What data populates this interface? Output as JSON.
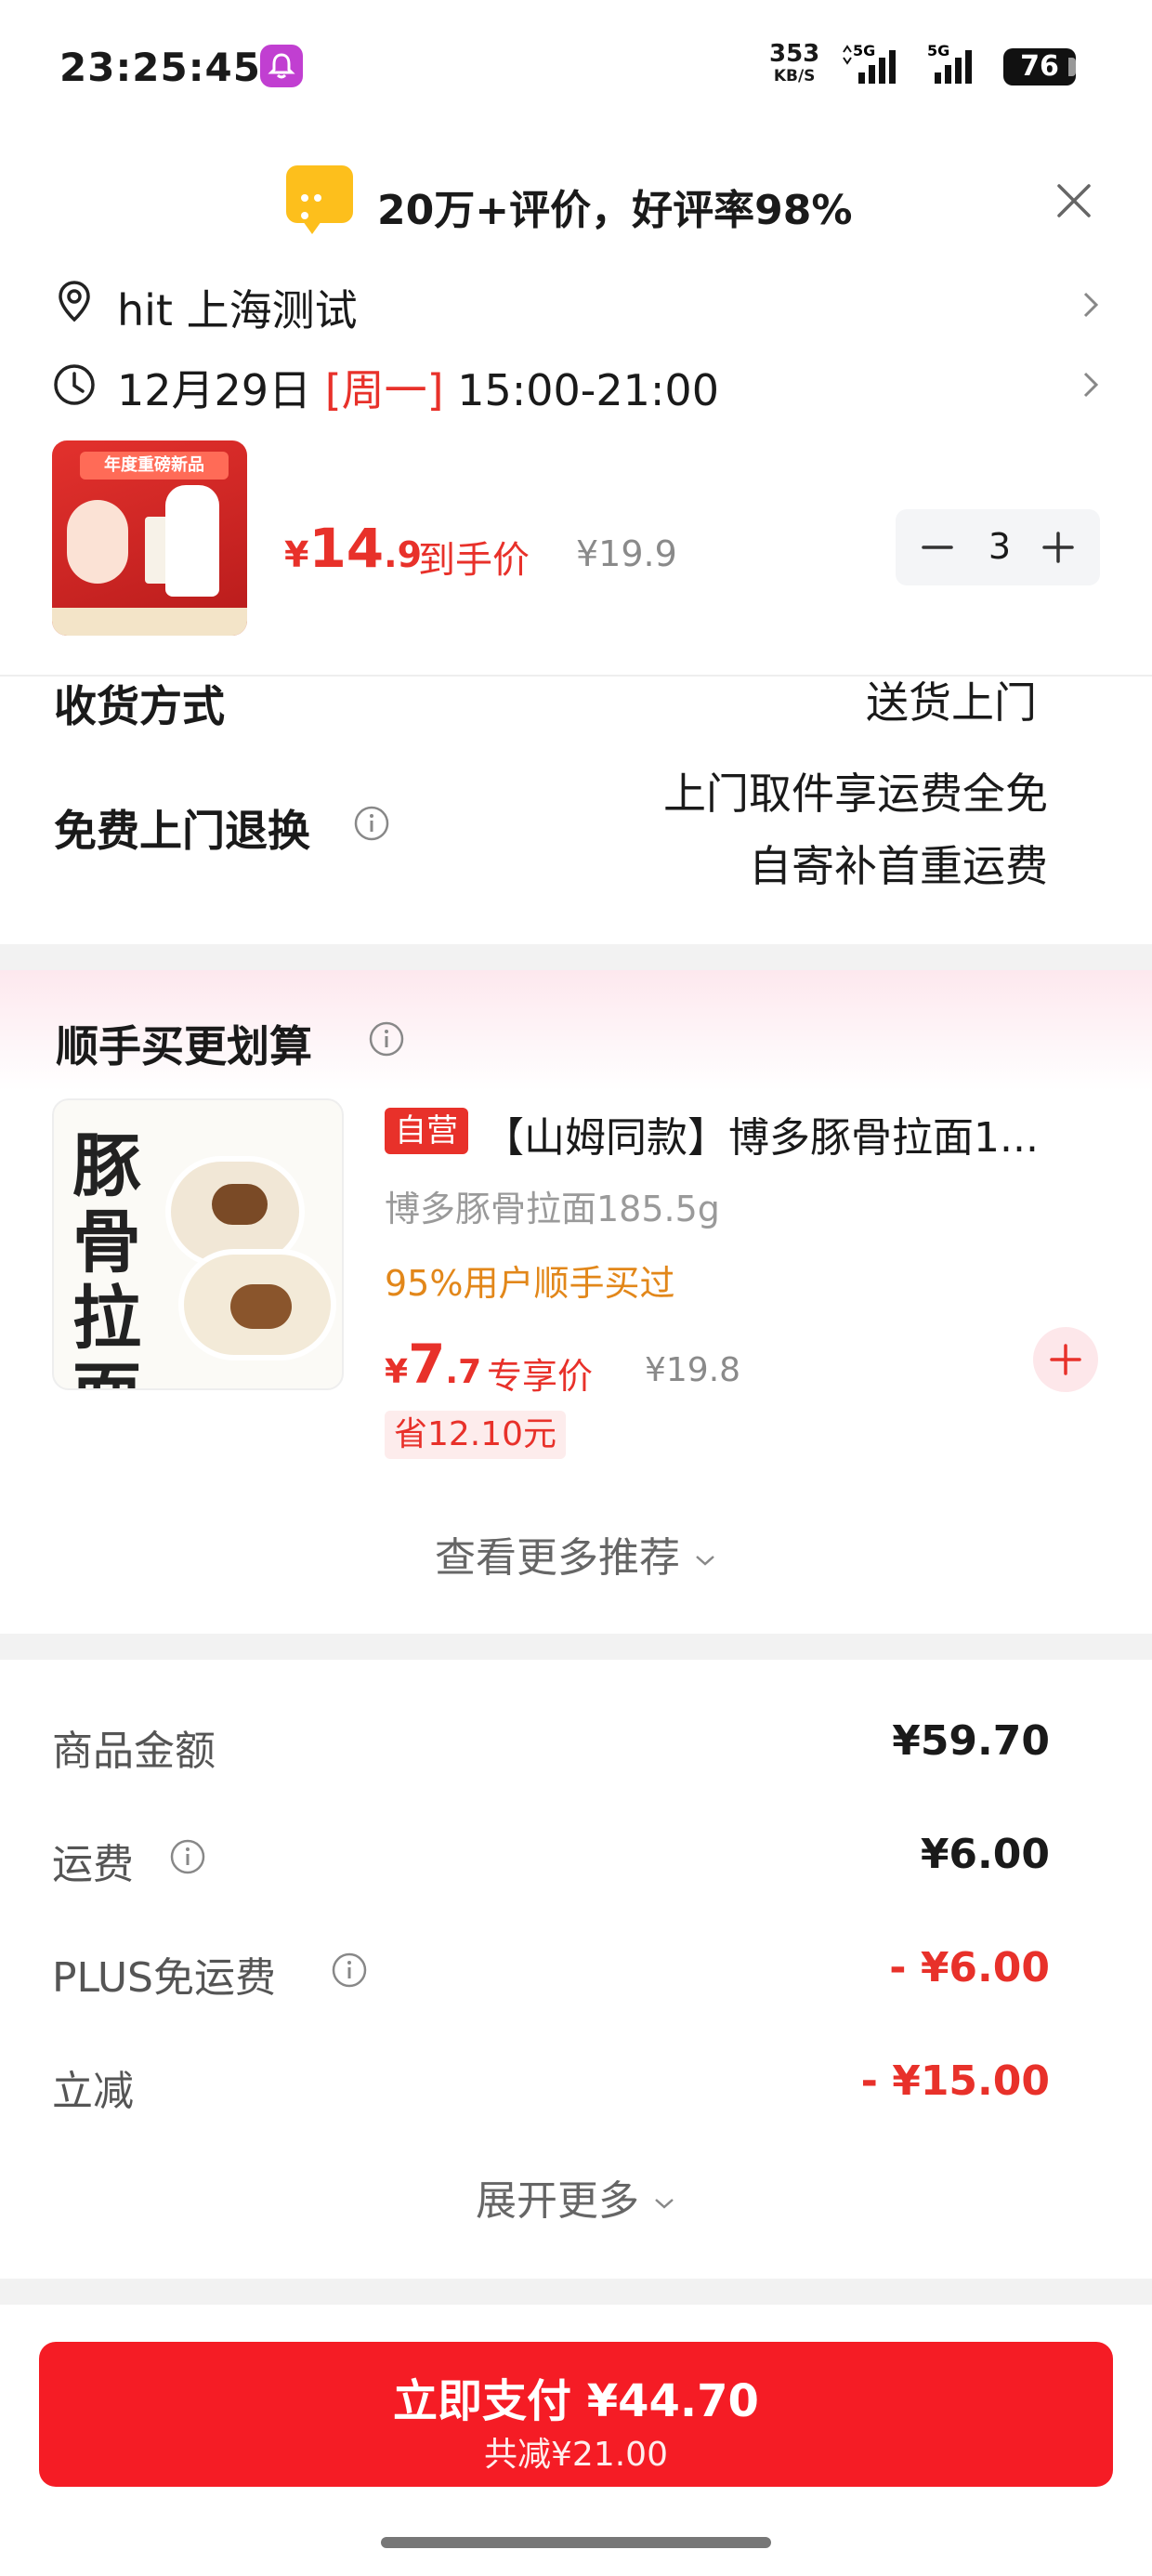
{
  "status_bar": {
    "time": "23:25:45",
    "net_speed": "353",
    "net_unit": "KB/S",
    "signal_1": "5G",
    "signal_2": "5G",
    "battery": "76"
  },
  "review_banner": {
    "text": "20万+评价，好评率98%"
  },
  "delivery": {
    "address": "hit  上海测试",
    "date": "12月29日 ",
    "weekday": "[周一]",
    "time_range": " 15:00-21:00"
  },
  "product": {
    "img_band": "年度重磅新品",
    "price_currency": "¥",
    "price_int": "14",
    "price_dec": ".9",
    "price_tag": "到手价",
    "original_price": "¥19.9",
    "quantity": "3"
  },
  "receive": {
    "label": "收货方式",
    "value": "送货上门"
  },
  "free_return": {
    "label": "免费上门退换",
    "line1": "上门取件享运费全免",
    "line2": "自寄补首重运费"
  },
  "recommend": {
    "title": "顺手买更划算",
    "img_title": "豚骨拉面",
    "self_badge": "自营",
    "name": "【山姆同款】博多豚骨拉面1...",
    "spec": "博多豚骨拉面185.5g",
    "buy_rate": "95%用户顺手买过",
    "price_currency": "¥",
    "price_int": "7",
    "price_dec": ".7",
    "price_tag": "专享价",
    "original_price": "¥19.8",
    "save": "省12.10元",
    "more": "查看更多推荐"
  },
  "cost": {
    "items": [
      {
        "label": "商品金额",
        "value": "¥59.70"
      },
      {
        "label": "运费",
        "value": "¥6.00"
      },
      {
        "label": "PLUS免运费",
        "value": "- ¥6.00"
      },
      {
        "label": "立减",
        "value": "- ¥15.00"
      }
    ],
    "expand": "展开更多"
  },
  "pay": {
    "main": "立即支付 ¥44.70",
    "sub": "共减¥21.00"
  },
  "colors": {
    "accent_red": "#e8312a",
    "pay_red": "#f51c25",
    "orange": "#e2871a"
  }
}
